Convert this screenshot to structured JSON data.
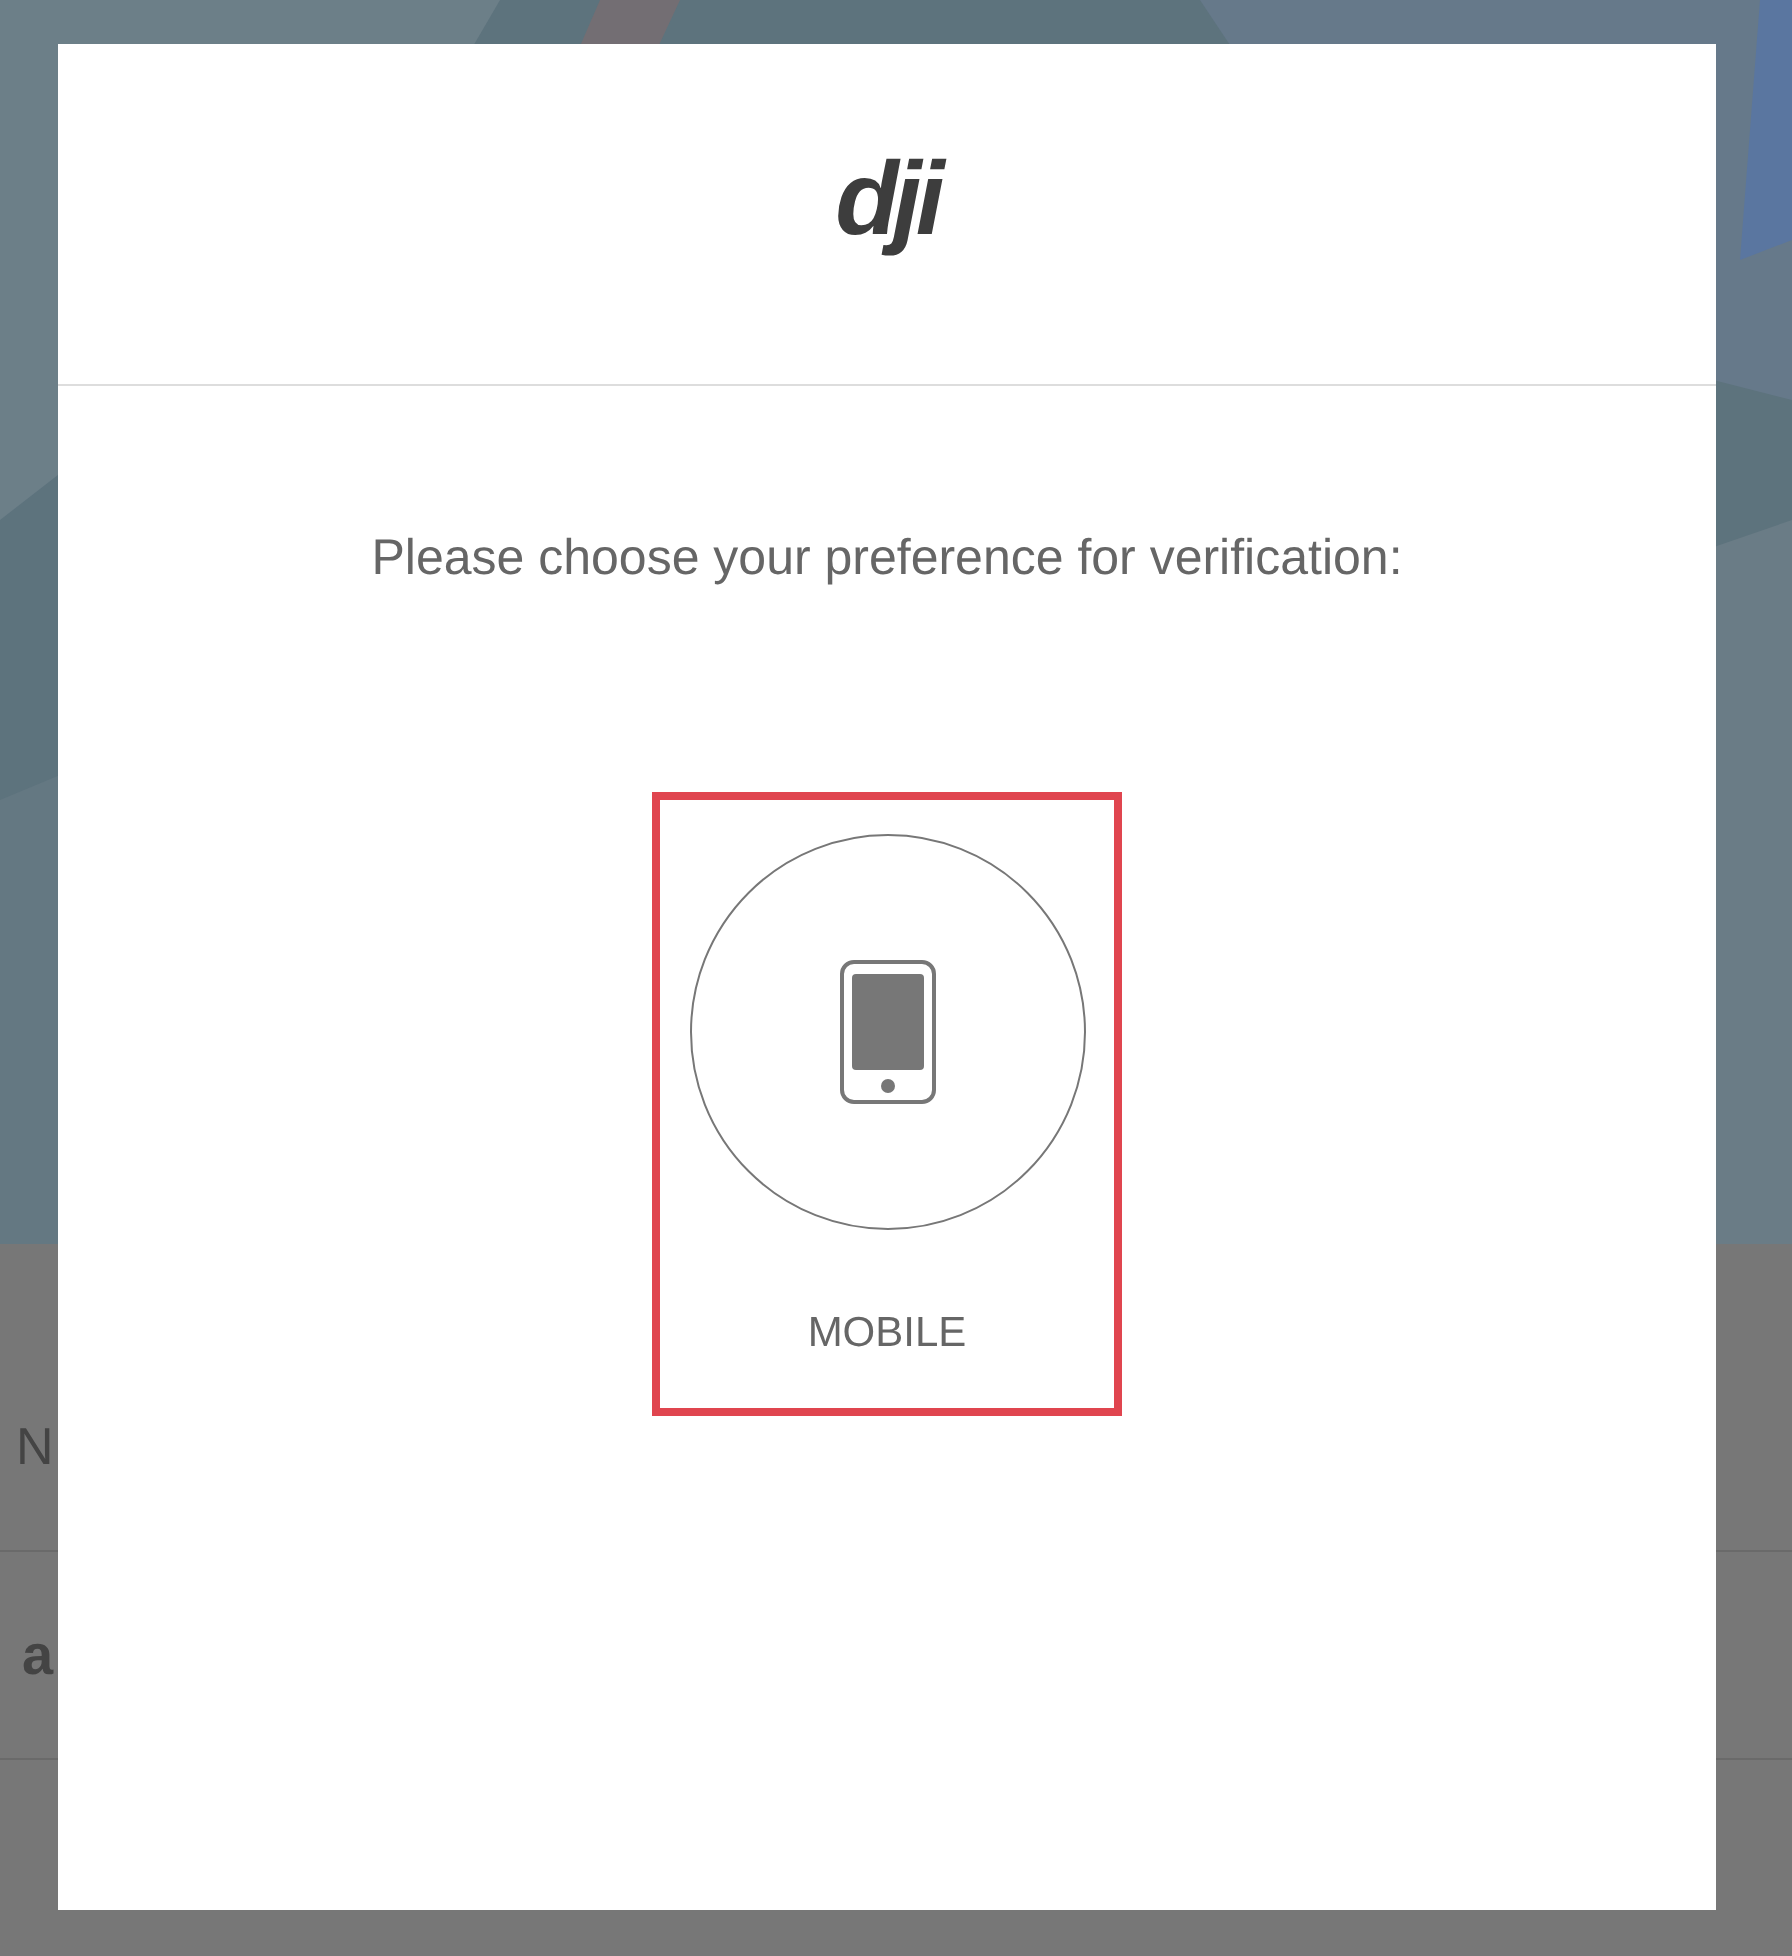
{
  "background": {
    "rows": [
      "N",
      "a"
    ]
  },
  "dialog": {
    "logo": "dji",
    "prompt": "Please choose your preference for verification:",
    "options": [
      {
        "label": "MOBILE",
        "highlighted": true
      }
    ]
  }
}
